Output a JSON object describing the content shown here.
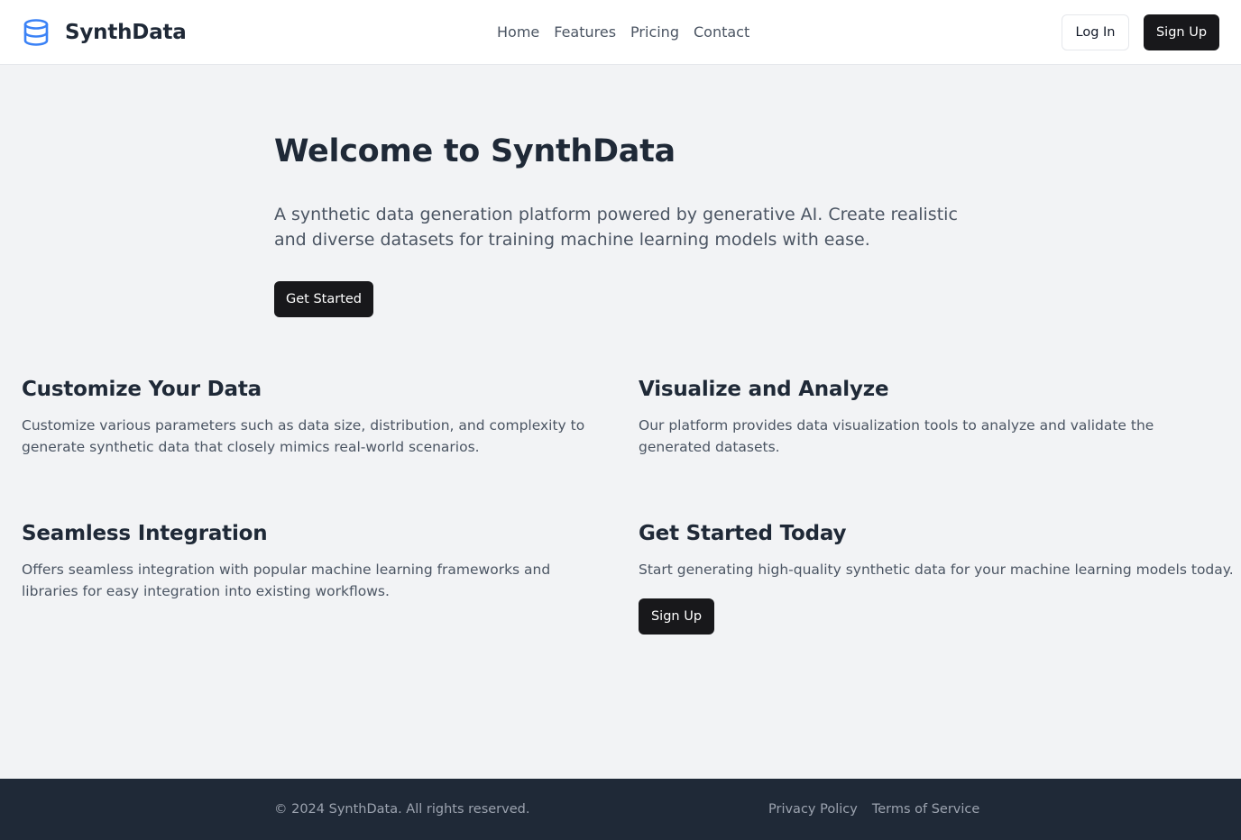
{
  "header": {
    "brand_name": "SynthData",
    "brand_icon": "database-icon",
    "nav": [
      "Home",
      "Features",
      "Pricing",
      "Contact"
    ],
    "login_label": "Log In",
    "signup_label": "Sign Up"
  },
  "hero": {
    "title": "Welcome to SynthData",
    "description": "A synthetic data generation platform powered by generative AI. Create realistic and diverse datasets for training machine learning models with ease.",
    "cta_label": "Get Started"
  },
  "features": [
    {
      "title": "Customize Your Data",
      "description": "Customize various parameters such as data size, distribution, and complexity to generate synthetic data that closely mimics real-world scenarios."
    },
    {
      "title": "Visualize and Analyze",
      "description": "Our platform provides data visualization tools to analyze and validate the generated datasets."
    },
    {
      "title": "Seamless Integration",
      "description": "Offers seamless integration with popular machine learning frameworks and libraries for easy integration into existing workflows."
    },
    {
      "title": "Get Started Today",
      "description": "Start generating high-quality synthetic data for your machine learning models today.",
      "cta_label": "Sign Up"
    }
  ],
  "footer": {
    "copyright": "© 2024 SynthData. All rights reserved.",
    "links": [
      "Privacy Policy",
      "Terms of Service"
    ]
  },
  "colors": {
    "accent": "#3b82f6",
    "dark_button": "#18181b",
    "footer_bg": "#1f2937",
    "page_bg": "#f2f3f5"
  }
}
